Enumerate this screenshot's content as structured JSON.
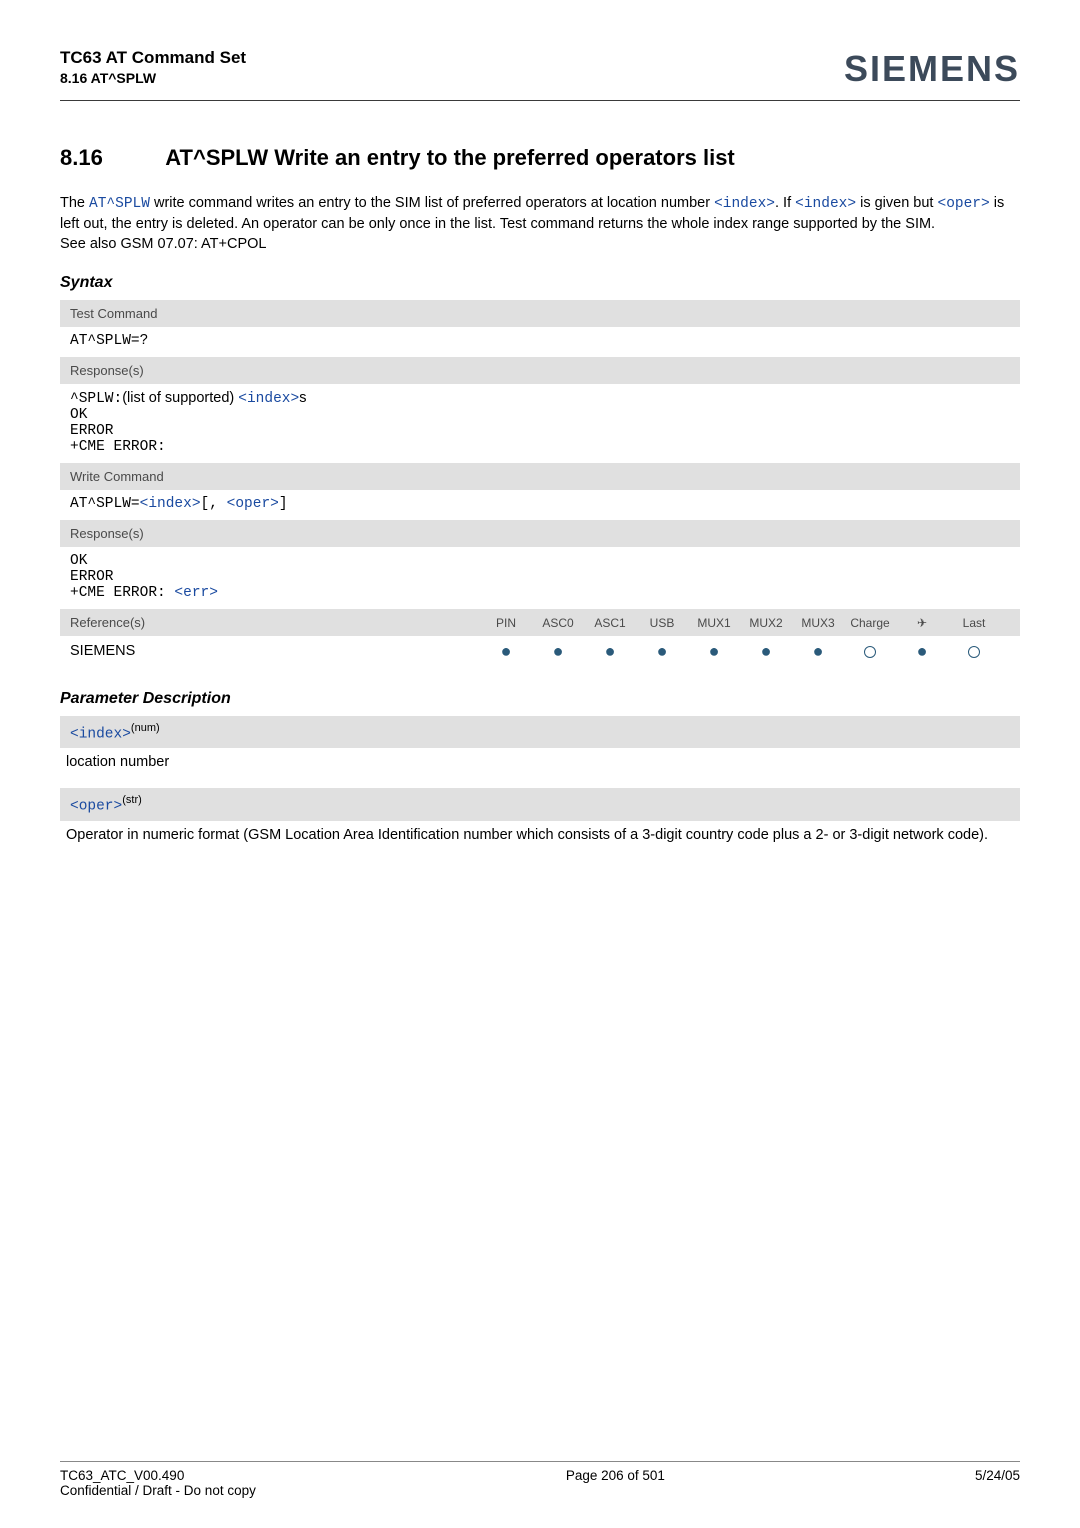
{
  "header": {
    "title": "TC63 AT Command Set",
    "sub": "8.16 AT^SPLW",
    "logo": "SIEMENS"
  },
  "section": {
    "number": "8.16",
    "title": "AT^SPLW   Write an entry to the preferred operators list"
  },
  "intro": {
    "p1a": "The ",
    "cmd1": "AT^SPLW",
    "p1b": " write command writes an entry to the SIM list of preferred operators at location number ",
    "idx1": "<index>",
    "p1c": ". If ",
    "idx2": "<index>",
    "p1d": " is given but ",
    "oper1": "<oper>",
    "p1e": " is left out, the entry is deleted. An operator can be only once in the list. Test command returns the whole index range supported by the SIM.",
    "p2": "See also GSM 07.07: AT+CPOL"
  },
  "syntax_label": "Syntax",
  "test": {
    "label": "Test Command",
    "cmd": "AT^SPLW=?",
    "resp_label": "Response(s)",
    "line1a": "^SPLW:",
    "line1b": "(list of supported) ",
    "line1c": "<index>",
    "line1d": "s",
    "ok": "OK",
    "error": "ERROR",
    "cme1": "+CME ERROR:"
  },
  "write": {
    "label": "Write Command",
    "cmd_a": "AT^SPLW=",
    "cmd_idx": "<index>",
    "cmd_b": "[, ",
    "cmd_oper": "<oper>",
    "cmd_c": "]",
    "resp_label": "Response(s)",
    "ok": "OK",
    "error": "ERROR",
    "cme_a": "+CME ERROR: ",
    "cme_b": "<err>"
  },
  "ref": {
    "label": "Reference(s)",
    "cols": [
      "PIN",
      "ASC0",
      "ASC1",
      "USB",
      "MUX1",
      "MUX2",
      "MUX3",
      "Charge",
      "✈",
      "Last"
    ],
    "siemens": "SIEMENS"
  },
  "param": {
    "heading": "Parameter Description",
    "index_label": "<index>",
    "index_sup": "(num)",
    "index_desc": "location number",
    "oper_label": "<oper>",
    "oper_sup": "(str)",
    "oper_desc": "Operator in numeric format (GSM Location Area Identification number which consists of a 3-digit country code plus a 2- or 3-digit network code)."
  },
  "footer": {
    "left1": "TC63_ATC_V00.490",
    "left2": "Confidential / Draft - Do not copy",
    "center": "Page 206 of 501",
    "right": "5/24/05"
  }
}
